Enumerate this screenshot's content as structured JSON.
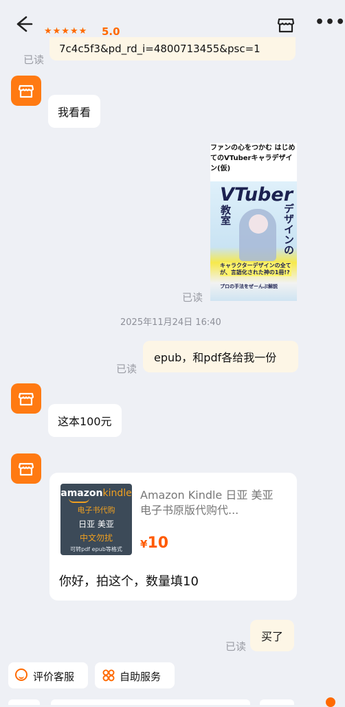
{
  "header": {
    "stars": "★★★★★",
    "rating": "5.0"
  },
  "read_label": "已读",
  "messages": {
    "link_tail": "7c4c5f3&pd_rd_i=4800713455&psc=1",
    "m1": "我看看",
    "book": {
      "title": "ファンの心をつかむ はじめてのVTuberキャラデザイン(仮)",
      "cover_big": "VTuber",
      "cover_side": "デザインの",
      "cover_left": "教室",
      "cover_band": "キャラクターデザインの全てが、言語化された神の1冊!?",
      "cover_bottom": "プロの手法をぜーんぶ解説"
    },
    "timestamp": "2025年11月24日 16:40",
    "m2": "epub，和pdf各给我一份",
    "m3": "这本100元",
    "card": {
      "kindle_brand_1": "amazon",
      "kindle_brand_2": "kindle",
      "kindle_line1": "电子书代购",
      "kindle_line2": "日亚 美亚",
      "kindle_line3": "中文勿扰",
      "kindle_line4": "可转pdf epub等格式",
      "product_title": "Amazon Kindle 日亚 美亚 电子书原版代购代...",
      "currency": "¥",
      "price": "10",
      "text": "你好，拍这个，数量填10"
    },
    "m4": "买了"
  },
  "bottom": {
    "btn1": "评价客服",
    "btn2": "自助服务"
  },
  "colors": {
    "accent": "#ff6a00",
    "my_bubble": "#fdf6e6",
    "avatar": "#ff7a12"
  }
}
